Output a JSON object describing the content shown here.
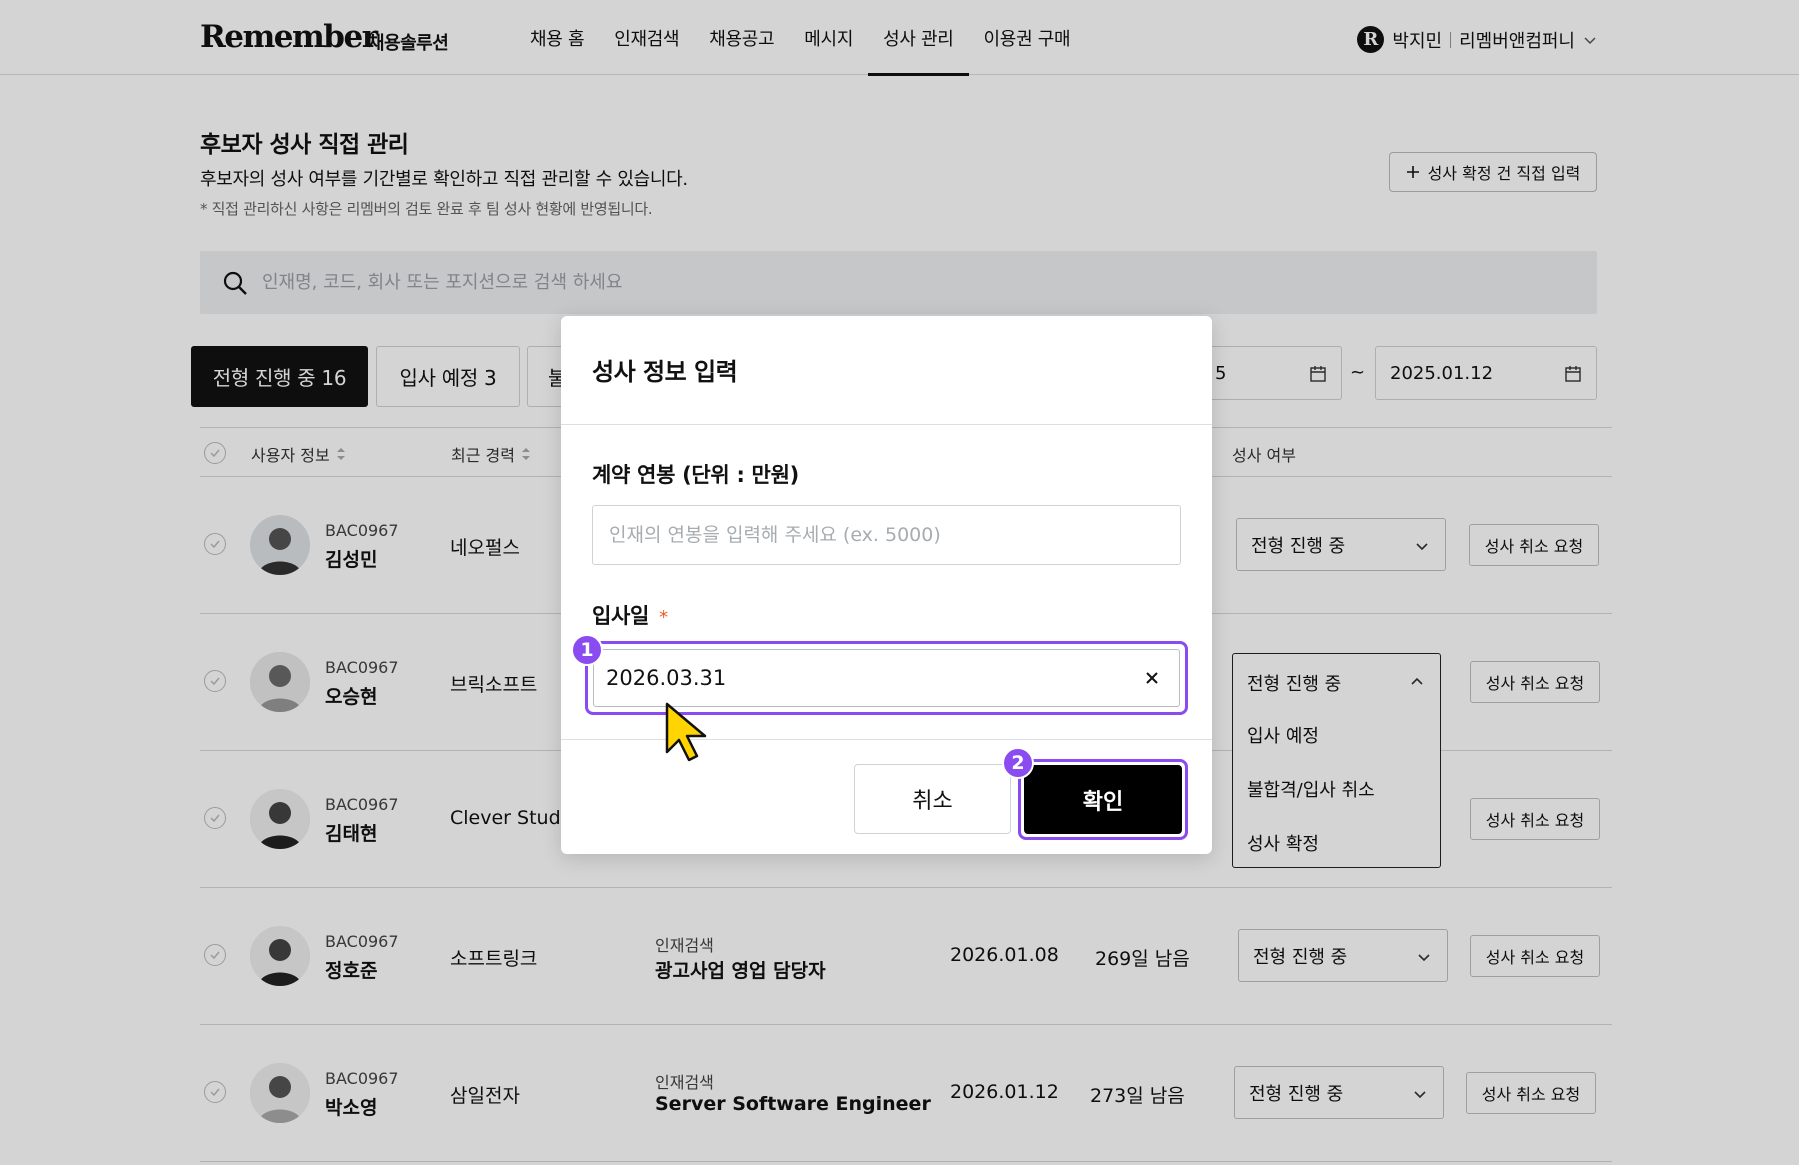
{
  "header": {
    "logo": "Remember",
    "logo_sub": "채용솔루션",
    "nav": [
      "채용 홈",
      "인재검색",
      "채용공고",
      "메시지",
      "성사 관리",
      "이용권 구매"
    ],
    "active_nav": "성사 관리",
    "user_badge": "R",
    "user_name": "박지민",
    "company": "리멤버앤컴퍼니"
  },
  "page": {
    "title": "후보자 성사 직접 관리",
    "description": "후보자의 성사 여부를 기간별로 확인하고 직접 관리할 수 있습니다.",
    "note": "* 직접 관리하신 사항은 리멤버의 검토 완료 후 팀 성사 현황에 반영됩니다.",
    "add_button": "성사 확정 건 직접 입력",
    "search_placeholder": "인재명, 코드, 회사 또는 포지션으로 검색 하세요"
  },
  "filters": {
    "tabs": [
      "전형 진행 중 16",
      "입사 예정 3",
      "불"
    ],
    "active_tab": "전형 진행 중 16",
    "date_from_partial": "5",
    "date_to": "2025.01.12",
    "tilde": "~"
  },
  "table": {
    "headers": {
      "user": "사용자 정보",
      "career": "최근 경력",
      "status": "성사 여부"
    },
    "rows": [
      {
        "code": "BAC0967",
        "name": "김성민",
        "company": "네오펄스",
        "source": "",
        "position": "",
        "date": "",
        "remaining": "",
        "status": "전형 진행 중",
        "action": "성사 취소 요청"
      },
      {
        "code": "BAC0967",
        "name": "오승현",
        "company": "브릭소프트",
        "source": "",
        "position": "",
        "date": "",
        "remaining": "",
        "status": "전형 진행 중",
        "action": "성사 취소 요청"
      },
      {
        "code": "BAC0967",
        "name": "김태현",
        "company": "Clever Studi",
        "source": "",
        "position": "",
        "date": "",
        "remaining": "",
        "status": "",
        "action": "성사 취소 요청"
      },
      {
        "code": "BAC0967",
        "name": "정호준",
        "company": "소프트링크",
        "source": "인재검색",
        "position": "광고사업 영업 담당자",
        "date": "2026.01.08",
        "remaining": "269일 남음",
        "status": "전형 진행 중",
        "action": "성사 취소 요청"
      },
      {
        "code": "BAC0967",
        "name": "박소영",
        "company": "삼일전자",
        "source": "인재검색",
        "position": "Server Software Engineer",
        "date": "2026.01.12",
        "remaining": "273일 남음",
        "status": "전형 진행 중",
        "action": "성사 취소 요청"
      }
    ],
    "dropdown": {
      "current": "전형 진행 중",
      "options": [
        "입사 예정",
        "불합격/입사 취소",
        "성사 확정"
      ]
    }
  },
  "modal": {
    "title": "성사 정보 입력",
    "salary_label": "계약 연봉 (단위 : 만원)",
    "salary_placeholder": "인재의 연봉을 입력해 주세요 (ex. 5000)",
    "start_date_label": "입사일",
    "required_mark": "*",
    "start_date_value": "2026.03.31",
    "cancel": "취소",
    "confirm": "확인",
    "step1": "1",
    "step2": "2"
  },
  "colors": {
    "accent": "#8a4cf0",
    "required": "#f05a28",
    "primary_button": "#000000",
    "cursor": "#ffd400"
  }
}
